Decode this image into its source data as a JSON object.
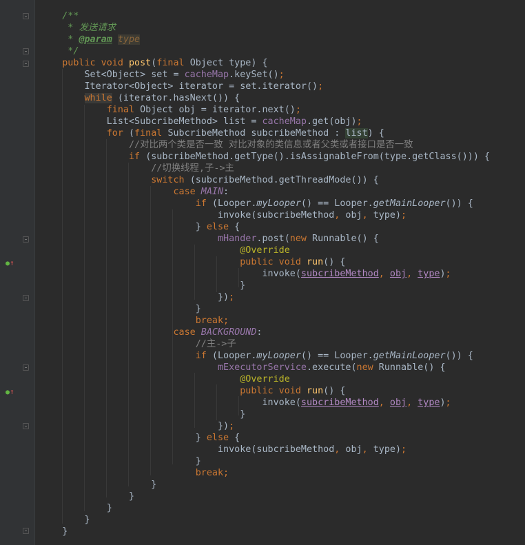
{
  "editor": {
    "lines": [
      [
        {
          "t": "    /**",
          "c": "doc"
        }
      ],
      [
        {
          "t": "     * ",
          "c": "doc"
        },
        {
          "t": "发送请求",
          "c": "doc"
        }
      ],
      [
        {
          "t": "     * ",
          "c": "doc"
        },
        {
          "t": "@param",
          "c": "doctag"
        },
        {
          "t": " ",
          "c": "doc"
        },
        {
          "t": "type",
          "c": "docparam"
        }
      ],
      [
        {
          "t": "     */",
          "c": "doc"
        }
      ],
      [
        {
          "t": "    ",
          "c": ""
        },
        {
          "t": "public void ",
          "c": "kw"
        },
        {
          "t": "post",
          "c": "fn"
        },
        {
          "t": "(",
          "c": ""
        },
        {
          "t": "final ",
          "c": "kw"
        },
        {
          "t": "Object type) {",
          "c": ""
        }
      ],
      [
        {
          "t": "        Set<Object> set = ",
          "c": ""
        },
        {
          "t": "cacheMap",
          "c": "fld"
        },
        {
          "t": ".keySet()",
          "c": ""
        },
        {
          "t": ";",
          "c": "kw"
        }
      ],
      [
        {
          "t": "        Iterator<Object> iterator = set.iterator()",
          "c": ""
        },
        {
          "t": ";",
          "c": "kw"
        }
      ],
      [
        {
          "t": "        ",
          "c": ""
        },
        {
          "t": "while",
          "c": "kw hl"
        },
        {
          "t": " (iterator.hasNext()) {",
          "c": ""
        }
      ],
      [
        {
          "t": "            ",
          "c": ""
        },
        {
          "t": "final ",
          "c": "kw"
        },
        {
          "t": "Object obj = iterator.next()",
          "c": ""
        },
        {
          "t": ";",
          "c": "kw"
        }
      ],
      [
        {
          "t": "            List<SubcribeMethod> list = ",
          "c": ""
        },
        {
          "t": "cacheMap",
          "c": "fld"
        },
        {
          "t": ".get(obj)",
          "c": ""
        },
        {
          "t": ";",
          "c": "kw"
        }
      ],
      [
        {
          "t": "            ",
          "c": ""
        },
        {
          "t": "for ",
          "c": "kw"
        },
        {
          "t": "(",
          "c": ""
        },
        {
          "t": "final ",
          "c": "kw"
        },
        {
          "t": "SubcribeMethod subcribeMethod : ",
          "c": ""
        },
        {
          "t": "list",
          "c": "wsel"
        },
        {
          "t": ") {",
          "c": ""
        }
      ],
      [
        {
          "t": "                ",
          "c": ""
        },
        {
          "t": "//对比两个类是否一致 对比对象的类信息或者父类或者接口是否一致",
          "c": "cmt"
        }
      ],
      [
        {
          "t": "                ",
          "c": ""
        },
        {
          "t": "if ",
          "c": "kw"
        },
        {
          "t": "(subcribeMethod.getType().isAssignableFrom(type.getClass())) {",
          "c": ""
        }
      ],
      [
        {
          "t": "                    ",
          "c": ""
        },
        {
          "t": "//切换线程,子->主",
          "c": "cmt"
        }
      ],
      [
        {
          "t": "                    ",
          "c": ""
        },
        {
          "t": "switch ",
          "c": "kw"
        },
        {
          "t": "(subcribeMethod.getThreadMode()) {",
          "c": ""
        }
      ],
      [
        {
          "t": "                        ",
          "c": ""
        },
        {
          "t": "case ",
          "c": "kw"
        },
        {
          "t": "MAIN",
          "c": "fld ital"
        },
        {
          "t": ":",
          "c": ""
        }
      ],
      [
        {
          "t": "                            ",
          "c": ""
        },
        {
          "t": "if ",
          "c": "kw"
        },
        {
          "t": "(Looper.",
          "c": ""
        },
        {
          "t": "myLooper",
          "c": "ital"
        },
        {
          "t": "() == Looper.",
          "c": ""
        },
        {
          "t": "getMainLooper",
          "c": "ital"
        },
        {
          "t": "()) {",
          "c": ""
        }
      ],
      [
        {
          "t": "                                invoke(subcribeMethod",
          "c": ""
        },
        {
          "t": ", ",
          "c": "kw"
        },
        {
          "t": "obj",
          "c": ""
        },
        {
          "t": ", ",
          "c": "kw"
        },
        {
          "t": "type)",
          "c": ""
        },
        {
          "t": ";",
          "c": "kw"
        }
      ],
      [
        {
          "t": "                            } ",
          "c": ""
        },
        {
          "t": "else ",
          "c": "kw"
        },
        {
          "t": "{",
          "c": ""
        }
      ],
      [
        {
          "t": "                                ",
          "c": ""
        },
        {
          "t": "mHander",
          "c": "fld"
        },
        {
          "t": ".post(",
          "c": ""
        },
        {
          "t": "new ",
          "c": "kw"
        },
        {
          "t": "Runnable() {",
          "c": ""
        }
      ],
      [
        {
          "t": "                                    ",
          "c": ""
        },
        {
          "t": "@Override",
          "c": "anno"
        }
      ],
      [
        {
          "t": "                                    ",
          "c": ""
        },
        {
          "t": "public void ",
          "c": "kw"
        },
        {
          "t": "run",
          "c": "fn"
        },
        {
          "t": "() {",
          "c": ""
        }
      ],
      [
        {
          "t": "                                        invoke(",
          "c": ""
        },
        {
          "t": "subcribeMethod",
          "c": "ul"
        },
        {
          "t": ", ",
          "c": "kw"
        },
        {
          "t": "obj",
          "c": "ul"
        },
        {
          "t": ", ",
          "c": "kw"
        },
        {
          "t": "type",
          "c": "ul"
        },
        {
          "t": ")",
          "c": ""
        },
        {
          "t": ";",
          "c": "kw"
        }
      ],
      [
        {
          "t": "                                    }",
          "c": ""
        }
      ],
      [
        {
          "t": "                                })",
          "c": ""
        },
        {
          "t": ";",
          "c": "kw"
        }
      ],
      [
        {
          "t": "                            }",
          "c": ""
        }
      ],
      [
        {
          "t": "                            ",
          "c": ""
        },
        {
          "t": "break;",
          "c": "kw"
        }
      ],
      [
        {
          "t": "                        ",
          "c": ""
        },
        {
          "t": "case ",
          "c": "kw"
        },
        {
          "t": "BACKGROUND",
          "c": "fld ital"
        },
        {
          "t": ":",
          "c": ""
        }
      ],
      [
        {
          "t": "                            ",
          "c": ""
        },
        {
          "t": "//主->子",
          "c": "cmt"
        }
      ],
      [
        {
          "t": "                            ",
          "c": ""
        },
        {
          "t": "if ",
          "c": "kw"
        },
        {
          "t": "(Looper.",
          "c": ""
        },
        {
          "t": "myLooper",
          "c": "ital"
        },
        {
          "t": "() == Looper.",
          "c": ""
        },
        {
          "t": "getMainLooper",
          "c": "ital"
        },
        {
          "t": "()) {",
          "c": ""
        }
      ],
      [
        {
          "t": "                                ",
          "c": ""
        },
        {
          "t": "mExecutorService",
          "c": "fld"
        },
        {
          "t": ".execute(",
          "c": ""
        },
        {
          "t": "new ",
          "c": "kw"
        },
        {
          "t": "Runnable() {",
          "c": ""
        }
      ],
      [
        {
          "t": "                                    ",
          "c": ""
        },
        {
          "t": "@Override",
          "c": "anno"
        }
      ],
      [
        {
          "t": "                                    ",
          "c": ""
        },
        {
          "t": "public void ",
          "c": "kw"
        },
        {
          "t": "run",
          "c": "fn"
        },
        {
          "t": "() {",
          "c": ""
        }
      ],
      [
        {
          "t": "                                        invoke(",
          "c": ""
        },
        {
          "t": "subcribeMethod",
          "c": "ul"
        },
        {
          "t": ", ",
          "c": "kw"
        },
        {
          "t": "obj",
          "c": "ul"
        },
        {
          "t": ", ",
          "c": "kw"
        },
        {
          "t": "type",
          "c": "ul"
        },
        {
          "t": ")",
          "c": ""
        },
        {
          "t": ";",
          "c": "kw"
        }
      ],
      [
        {
          "t": "                                    }",
          "c": ""
        }
      ],
      [
        {
          "t": "                                })",
          "c": ""
        },
        {
          "t": ";",
          "c": "kw"
        }
      ],
      [
        {
          "t": "                            } ",
          "c": ""
        },
        {
          "t": "else ",
          "c": "kw"
        },
        {
          "t": "{",
          "c": ""
        }
      ],
      [
        {
          "t": "                                invoke(subcribeMethod",
          "c": ""
        },
        {
          "t": ", ",
          "c": "kw"
        },
        {
          "t": "obj",
          "c": ""
        },
        {
          "t": ", ",
          "c": "kw"
        },
        {
          "t": "type)",
          "c": ""
        },
        {
          "t": ";",
          "c": "kw"
        }
      ],
      [
        {
          "t": "                            }",
          "c": ""
        }
      ],
      [
        {
          "t": "                            ",
          "c": ""
        },
        {
          "t": "break;",
          "c": "kw"
        }
      ],
      [
        {
          "t": "                    }",
          "c": ""
        }
      ],
      [
        {
          "t": "                }",
          "c": ""
        }
      ],
      [
        {
          "t": "            }",
          "c": ""
        }
      ],
      [
        {
          "t": "        }",
          "c": ""
        }
      ],
      [
        {
          "t": "    }",
          "c": ""
        }
      ]
    ]
  },
  "gutter": {
    "override_marker_icon": "override-up-arrow-icon",
    "fold_marker_icon": "fold-minus-icon"
  },
  "theme": {
    "background": "#2b2b2b",
    "gutter": "#313335",
    "keyword": "#cc7832",
    "method": "#ffc66d",
    "field": "#9876aa",
    "comment": "#808080",
    "doc": "#629755",
    "annotation": "#bbb529"
  }
}
